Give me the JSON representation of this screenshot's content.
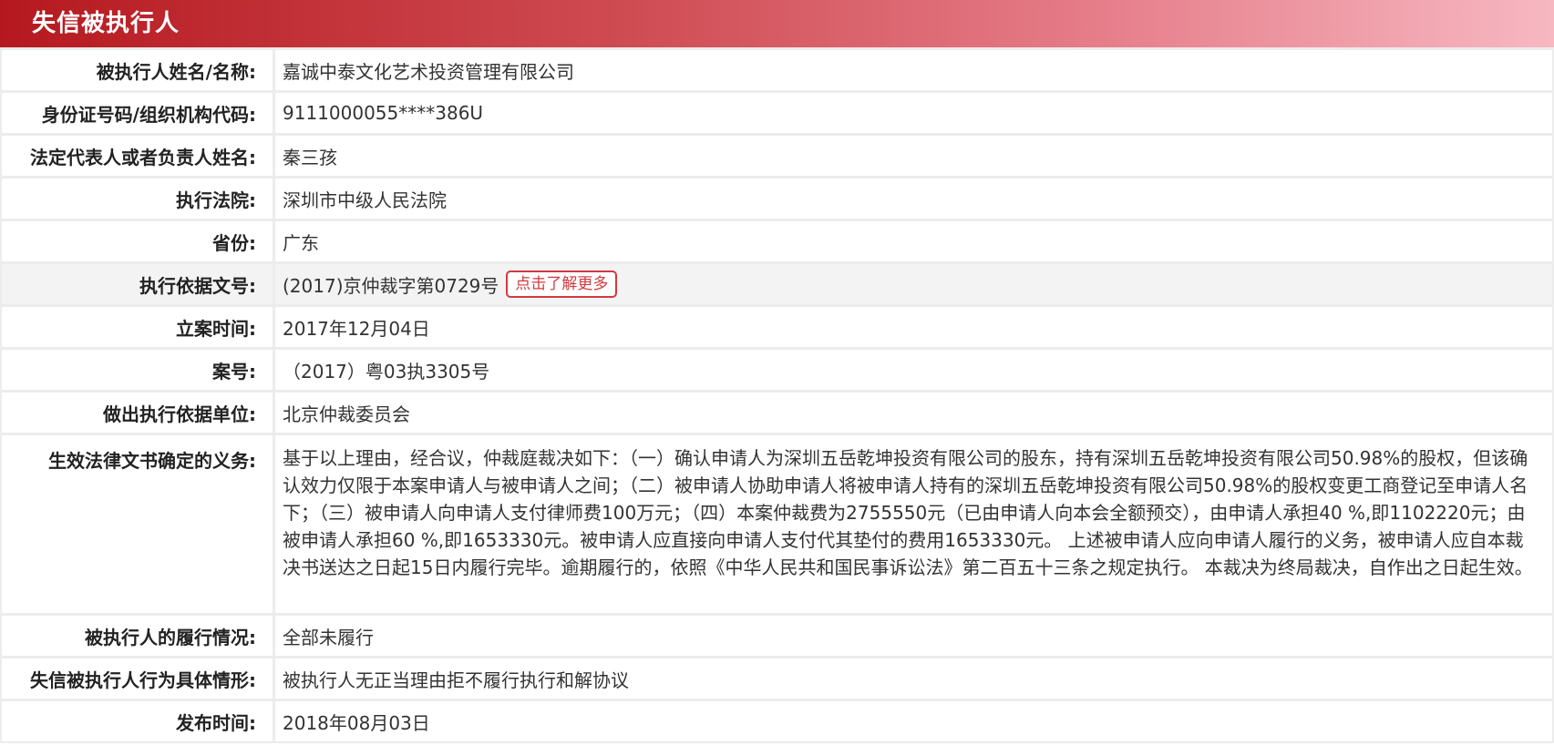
{
  "header": {
    "title": "失信被执行人"
  },
  "fields": [
    {
      "label": "被执行人姓名/名称:",
      "value": "嘉诚中泰文化艺术投资管理有限公司"
    },
    {
      "label": "身份证号码/组织机构代码:",
      "value": "9111000055****386U"
    },
    {
      "label": "法定代表人或者负责人姓名:",
      "value": "秦三孩"
    },
    {
      "label": "执行法院:",
      "value": "深圳市中级人民法院"
    },
    {
      "label": "省份:",
      "value": "广东"
    },
    {
      "label": "执行依据文号:",
      "value": "(2017)京仲裁字第0729号",
      "button": "点击了解更多"
    },
    {
      "label": "立案时间:",
      "value": "2017年12月04日"
    },
    {
      "label": "案号:",
      "value": "（2017）粤03执3305号"
    },
    {
      "label": "做出执行依据单位:",
      "value": "北京仲裁委员会"
    },
    {
      "label": "生效法律文书确定的义务:",
      "value": "基于以上理由，经合议，仲裁庭裁决如下：（一）确认申请人为深圳五岳乾坤投资有限公司的股东，持有深圳五岳乾坤投资有限公司50.98%的股权，但该确认效力仅限于本案申请人与被申请人之间；（二）被申请人协助申请人将被申请人持有的深圳五岳乾坤投资有限公司50.98%的股权变更工商登记至申请人名下；（三）被申请人向申请人支付律师费100万元；（四）本案仲裁费为2755550元（已由申请人向本会全额预交），由申请人承担40 %,即1102220元；由被申请人承担60 %,即1653330元。被申请人应直接向申请人支付代其垫付的费用1653330元。 上述被申请人应向申请人履行的义务，被申请人应自本裁决书送达之日起15日内履行完毕。逾期履行的，依照《中华人民共和国民事诉讼法》第二百五十三条之规定执行。 本裁决为终局裁决，自作出之日起生效。"
    },
    {
      "label": "被执行人的履行情况:",
      "value": "全部未履行"
    },
    {
      "label": "失信被执行人行为具体情形:",
      "value": "被执行人无正当理由拒不履行执行和解协议"
    },
    {
      "label": "发布时间:",
      "value": "2018年08月03日"
    }
  ]
}
